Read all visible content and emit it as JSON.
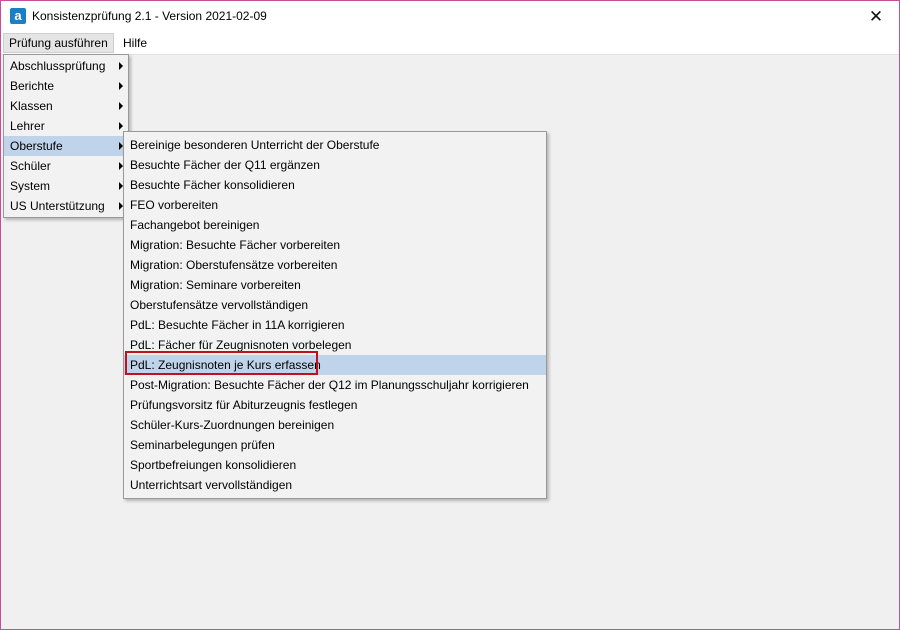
{
  "window": {
    "title": "Konsistenzprüfung 2.1 - Version 2021-02-09",
    "app_icon_letter": "a",
    "close_glyph": "✕"
  },
  "menubar": {
    "items": [
      {
        "label": "Prüfung ausführen"
      },
      {
        "label": "Hilfe"
      }
    ]
  },
  "main_menu": {
    "items": [
      {
        "label": "Abschlussprüfung"
      },
      {
        "label": "Berichte"
      },
      {
        "label": "Klassen"
      },
      {
        "label": "Lehrer"
      },
      {
        "label": "Oberstufe"
      },
      {
        "label": "Schüler"
      },
      {
        "label": "System"
      },
      {
        "label": "US Unterstützung"
      }
    ]
  },
  "submenu_oberstufe": {
    "items": [
      {
        "label": "Bereinige besonderen Unterricht der Oberstufe"
      },
      {
        "label": "Besuchte Fächer der Q11 ergänzen"
      },
      {
        "label": "Besuchte Fächer konsolidieren"
      },
      {
        "label": "FEO vorbereiten"
      },
      {
        "label": "Fachangebot bereinigen"
      },
      {
        "label": "Migration: Besuchte Fächer vorbereiten"
      },
      {
        "label": "Migration: Oberstufensätze vorbereiten"
      },
      {
        "label": "Migration: Seminare vorbereiten"
      },
      {
        "label": "Oberstufensätze vervollständigen"
      },
      {
        "label": "PdL: Besuchte Fächer in 11A korrigieren"
      },
      {
        "label": "PdL: Fächer für Zeugnisnoten vorbelegen"
      },
      {
        "label": "PdL: Zeugnisnoten je Kurs erfassen"
      },
      {
        "label": "Post-Migration: Besuchte Fächer der Q12 im Planungsschuljahr korrigieren"
      },
      {
        "label": "Prüfungsvorsitz für Abiturzeugnis festlegen"
      },
      {
        "label": "Schüler-Kurs-Zuordnungen bereinigen"
      },
      {
        "label": "Seminarbelegungen prüfen"
      },
      {
        "label": "Sportbefreiungen konsolidieren"
      },
      {
        "label": "Unterrichtsart vervollständigen"
      }
    ]
  },
  "colors": {
    "menu_hover": "#bfd3ea",
    "highlight_border": "#c0121a",
    "window_border": "#c94b9b"
  }
}
